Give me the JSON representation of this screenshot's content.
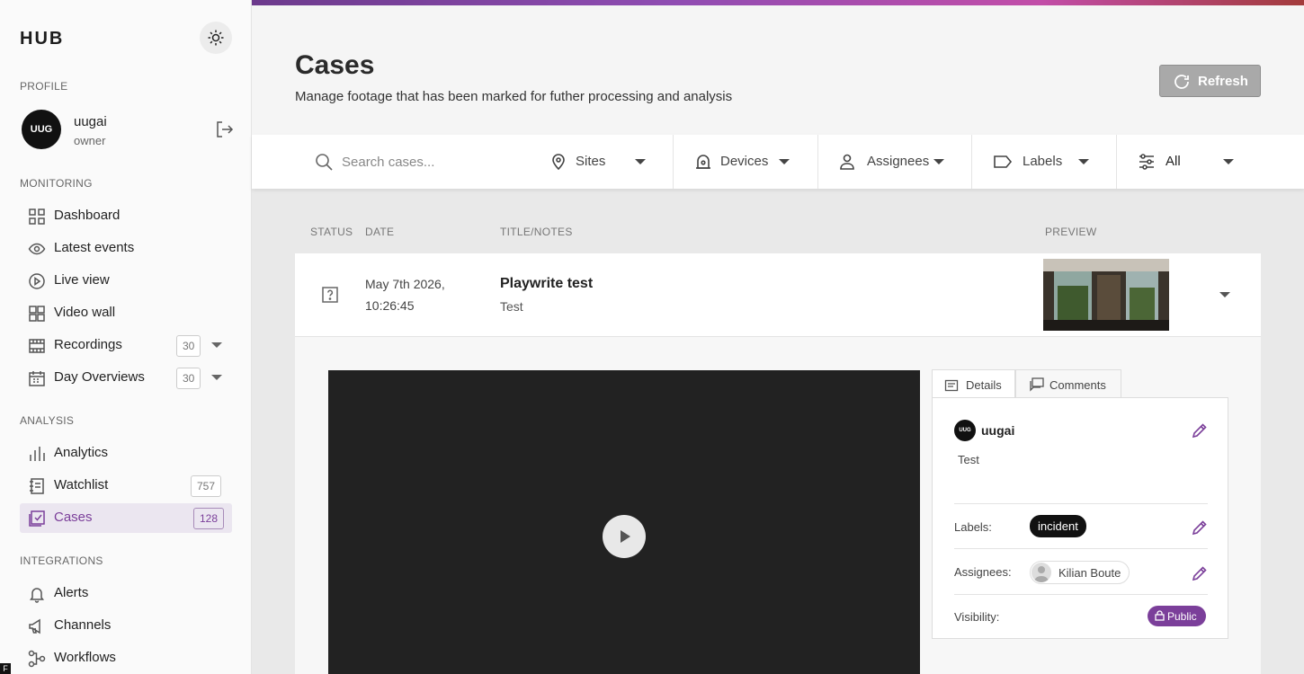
{
  "app": {
    "logo": "HUB"
  },
  "sidebar": {
    "profile_title": "PROFILE",
    "user": {
      "initials": "UUG",
      "name": "uugai",
      "role": "owner"
    },
    "sections": {
      "monitoring": "MONITORING",
      "analysis": "ANALYSIS",
      "integrations": "INTEGRATIONS"
    },
    "items": [
      {
        "label": "Dashboard",
        "icon": "dashboard-icon"
      },
      {
        "label": "Latest events",
        "icon": "eye-icon"
      },
      {
        "label": "Live view",
        "icon": "play-circle-icon"
      },
      {
        "label": "Video wall",
        "icon": "grid-icon"
      },
      {
        "label": "Recordings",
        "icon": "film-icon",
        "badge": "30"
      },
      {
        "label": "Day Overviews",
        "icon": "calendar-icon",
        "badge": "30"
      },
      {
        "label": "Analytics",
        "icon": "bar-chart-icon"
      },
      {
        "label": "Watchlist",
        "icon": "list-icon",
        "badge": "757"
      },
      {
        "label": "Cases",
        "icon": "cases-icon",
        "badge": "128",
        "active": true
      },
      {
        "label": "Alerts",
        "icon": "bell-icon"
      },
      {
        "label": "Channels",
        "icon": "megaphone-icon"
      },
      {
        "label": "Workflows",
        "icon": "workflow-icon"
      }
    ]
  },
  "header": {
    "title": "Cases",
    "subtitle": "Manage footage that has been marked for futher processing and analysis",
    "refresh_label": "Refresh"
  },
  "filters": {
    "search_placeholder": "Search cases...",
    "sites": "Sites",
    "devices": "Devices",
    "assignees": "Assignees",
    "labels": "Labels",
    "status": "All"
  },
  "table": {
    "columns": {
      "status": "STATUS",
      "date": "DATE",
      "title": "TITLE/NOTES",
      "preview": "PREVIEW"
    },
    "rows": [
      {
        "date_line1": "May 7th 2026,",
        "date_line2": "10:26:45",
        "title": "Playwrite test",
        "note": "Test"
      }
    ]
  },
  "details": {
    "tabs": {
      "details": "Details",
      "comments": "Comments"
    },
    "author_initials": "UUG",
    "author": "uugai",
    "note": "Test",
    "labels_label": "Labels:",
    "label_value": "incident",
    "assignees_label": "Assignees:",
    "assignee": "Kilian Boute",
    "visibility_label": "Visibility:",
    "visibility_value": "Public"
  },
  "colors": {
    "accent": "#7b3f9a",
    "active_bg": "#ebe6f0"
  }
}
